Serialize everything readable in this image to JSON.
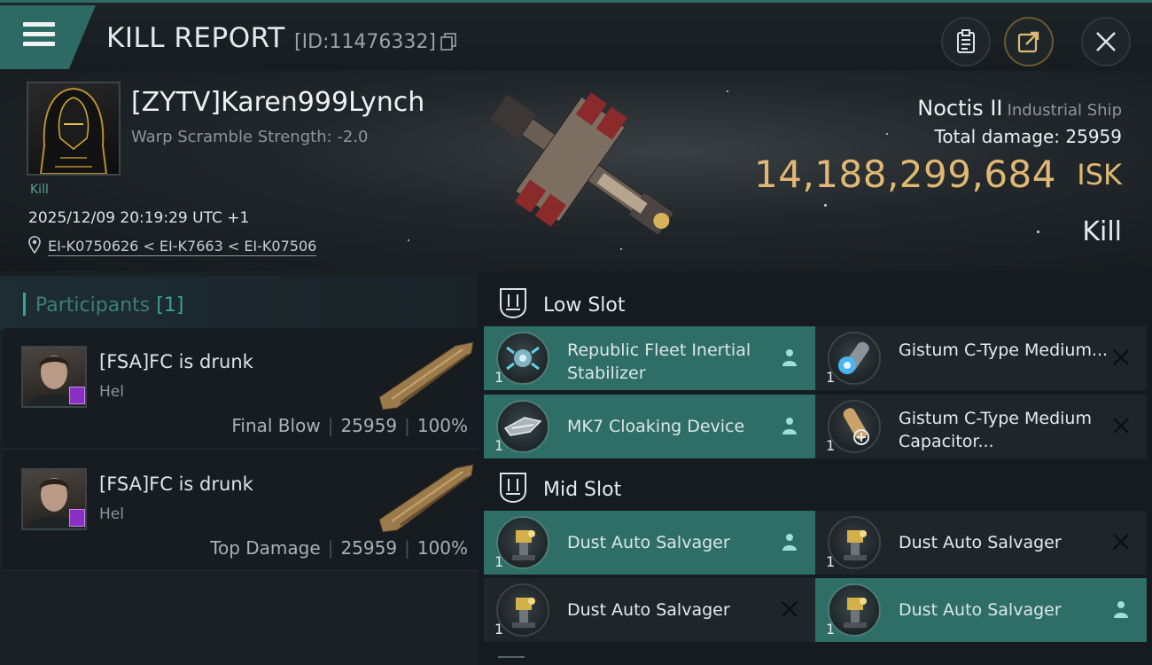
{
  "header": {
    "title": "KILL REPORT",
    "report_id": "[ID:11476332]"
  },
  "victim": {
    "name": "[ZYTV]Karen999Lynch",
    "warp_scramble": "Warp Scramble Strength: -2.0",
    "kill_tag": "Kill",
    "time": "2025/12/09 20:19:29 UTC +1",
    "system_path": "EI-K0750626 < EI-K7663 < EI-K07506",
    "ship_name": "Noctis II",
    "ship_class": "Industrial Ship",
    "total_damage": "Total damage:  25959",
    "isk_value": "14,188,299,684",
    "isk_unit": "ISK",
    "result": "Kill"
  },
  "participants": {
    "title": "Participants",
    "count": "[1]",
    "rows": [
      {
        "name": "[FSA]FC is drunk",
        "ship": "Hel",
        "role": "Final Blow",
        "damage": "25959",
        "percent": "100%"
      },
      {
        "name": "[FSA]FC is drunk",
        "ship": "Hel",
        "role": "Top Damage",
        "damage": "25959",
        "percent": "100%"
      }
    ]
  },
  "fitting": {
    "low_slot_label": "Low Slot",
    "mid_slot_label": "Mid Slot",
    "low": [
      {
        "name": "Republic Fleet Inertial Stabilizer",
        "qty": "1",
        "state": "fitted"
      },
      {
        "name": "Gistum C-Type Medium...",
        "qty": "1",
        "state": "destroyed"
      },
      {
        "name": "MK7 Cloaking Device",
        "qty": "1",
        "state": "fitted"
      },
      {
        "name": "Gistum C-Type Medium Capacitor...",
        "qty": "1",
        "state": "destroyed"
      }
    ],
    "mid": [
      {
        "name": "Dust Auto Salvager",
        "qty": "1",
        "state": "fitted"
      },
      {
        "name": "Dust Auto Salvager",
        "qty": "1",
        "state": "destroyed"
      },
      {
        "name": "Dust Auto Salvager",
        "qty": "1",
        "state": "destroyed"
      },
      {
        "name": "Dust Auto Salvager",
        "qty": "1",
        "state": "fitted"
      }
    ]
  },
  "colors": {
    "accent_teal": "#2e6e67",
    "isk_gold": "#e0b873",
    "badge_purple": "#8a2fc4"
  }
}
